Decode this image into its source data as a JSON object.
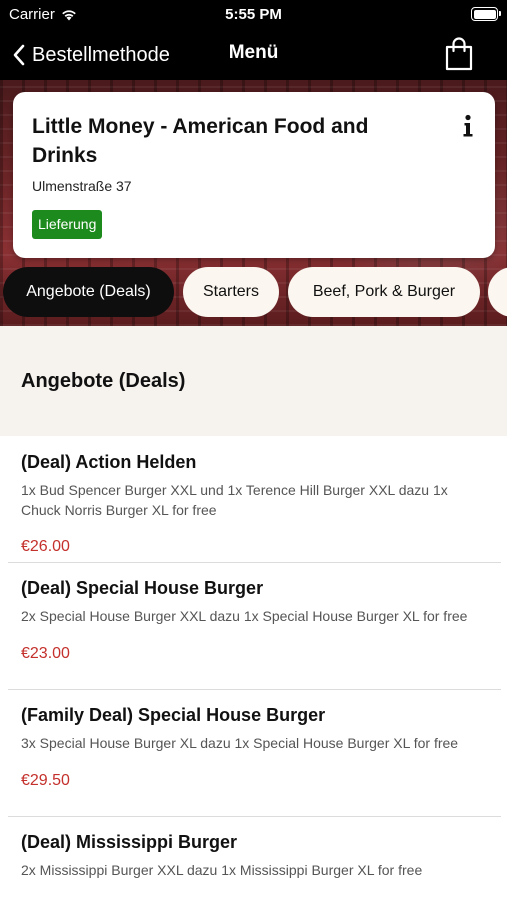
{
  "status_bar": {
    "carrier": "Carrier",
    "time": "5:55 PM"
  },
  "nav": {
    "back_label": "Bestellmethode",
    "title": "Menü",
    "icons": {
      "back": "chevron-left-icon",
      "cart": "shopping-bag-icon"
    }
  },
  "restaurant": {
    "name": "Little Money - American Food and Drinks",
    "address": "Ulmenstraße 37",
    "delivery_badge": "Lieferung",
    "badge_color": "#1d8a1d"
  },
  "categories": [
    {
      "label": "Angebote (Deals)",
      "active": true
    },
    {
      "label": "Starters",
      "active": false
    },
    {
      "label": "Beef, Pork & Burger",
      "active": false
    },
    {
      "label": "",
      "active": false
    }
  ],
  "section": {
    "title": "Angebote (Deals)"
  },
  "menu_items": [
    {
      "name": "(Deal) Action Helden",
      "description": "1x Bud Spencer Burger XXL und 1x Terence Hill Burger XXL dazu 1x Chuck Norris Burger XL for free",
      "price": "€26.00"
    },
    {
      "name": "(Deal) Special House Burger",
      "description": "2x Special House Burger XXL dazu 1x Special House Burger XL for free",
      "price": "€23.00"
    },
    {
      "name": "(Family Deal) Special House Burger",
      "description": "3x Special House Burger XL dazu 1x Special House Burger XL for free",
      "price": "€29.50"
    },
    {
      "name": "(Deal) Mississippi Burger",
      "description": "2x Mississippi Burger XXL dazu 1x Mississippi Burger XL for free",
      "price": ""
    }
  ],
  "colors": {
    "price": "#c4302b",
    "active_tab": "#0e0e0e",
    "inactive_tab": "#fbf6ef",
    "section_bg": "#f6f2ed"
  }
}
